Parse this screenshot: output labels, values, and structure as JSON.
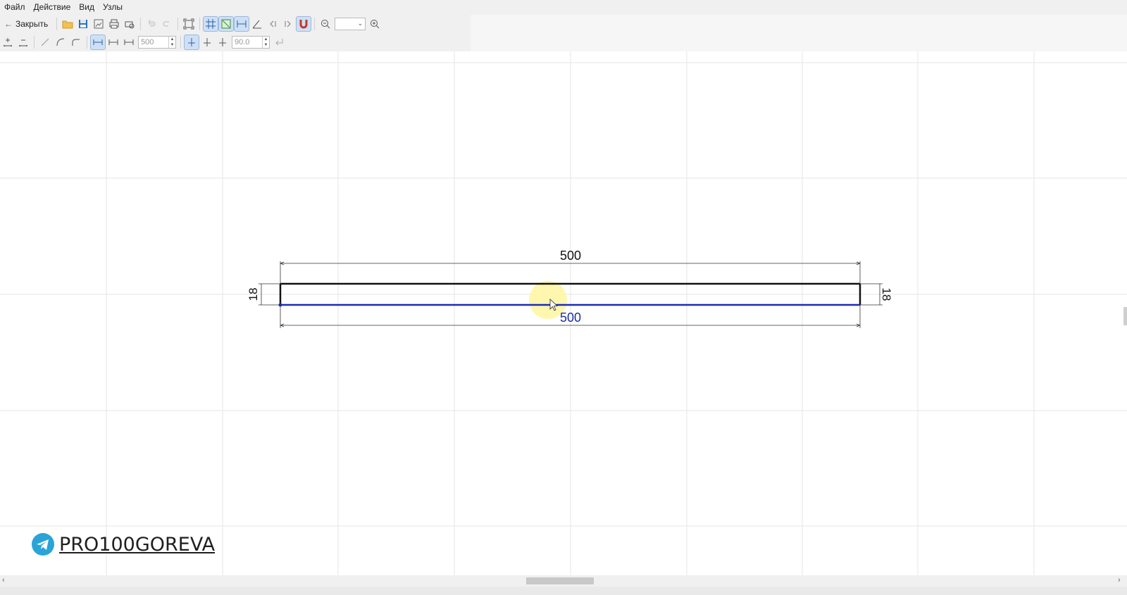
{
  "menu": [
    "Файл",
    "Действие",
    "Вид",
    "Узлы"
  ],
  "toolbar": {
    "close_label": "Закрыть",
    "zoom_value": "",
    "length_value": "500",
    "angle_value": "90.0"
  },
  "drawing": {
    "dim_top": "500",
    "dim_bottom": "500",
    "dim_left": "18",
    "dim_right": "18",
    "edge_color": "#111111",
    "selected_edge_color": "#1a2db8"
  },
  "watermark": {
    "text": "PRO100GOREVA",
    "icon": "telegram-icon"
  },
  "colors": {
    "selection_dim": "#1a2d9e",
    "grid": "#e6e6e6",
    "highlight": "#fff6a0"
  }
}
